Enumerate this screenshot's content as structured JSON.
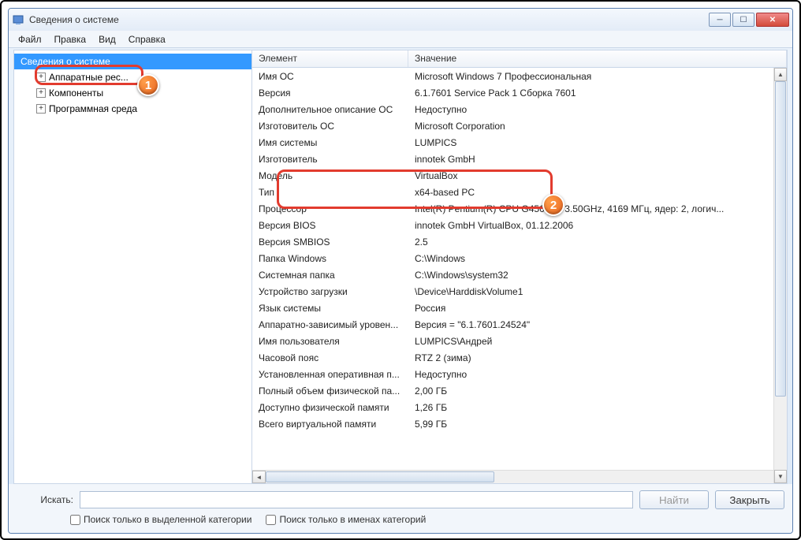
{
  "window": {
    "title": "Сведения о системе"
  },
  "menu": {
    "file": "Файл",
    "edit": "Правка",
    "view": "Вид",
    "help": "Справка"
  },
  "tree": {
    "root": "Сведения о системе",
    "hw": "Аппаратные рес...",
    "comp": "Компоненты",
    "soft": "Программная среда"
  },
  "list": {
    "header_element": "Элемент",
    "header_value": "Значение",
    "rows": [
      {
        "k": "Имя ОС",
        "v": "Microsoft Windows 7 Профессиональная"
      },
      {
        "k": "Версия",
        "v": "6.1.7601 Service Pack 1 Сборка 7601"
      },
      {
        "k": "Дополнительное описание ОС",
        "v": "Недоступно"
      },
      {
        "k": "Изготовитель ОС",
        "v": "Microsoft Corporation"
      },
      {
        "k": "Имя системы",
        "v": "LUMPICS"
      },
      {
        "k": "Изготовитель",
        "v": "innotek GmbH"
      },
      {
        "k": "Модель",
        "v": "VirtualBox"
      },
      {
        "k": "Тип",
        "v": "x64-based PC"
      },
      {
        "k": "Процессор",
        "v": "Intel(R) Pentium(R) CPU G4560 @ 3.50GHz, 4169 МГц, ядер: 2, логич..."
      },
      {
        "k": "Версия BIOS",
        "v": "innotek GmbH VirtualBox, 01.12.2006"
      },
      {
        "k": "Версия SMBIOS",
        "v": "2.5"
      },
      {
        "k": "Папка Windows",
        "v": "C:\\Windows"
      },
      {
        "k": "Системная папка",
        "v": "C:\\Windows\\system32"
      },
      {
        "k": "Устройство загрузки",
        "v": "\\Device\\HarddiskVolume1"
      },
      {
        "k": "Язык системы",
        "v": "Россия"
      },
      {
        "k": "Аппаратно-зависимый уровен...",
        "v": "Версия = \"6.1.7601.24524\""
      },
      {
        "k": "Имя пользователя",
        "v": "LUMPICS\\Андрей"
      },
      {
        "k": "Часовой пояс",
        "v": "RTZ 2 (зима)"
      },
      {
        "k": "Установленная оперативная п...",
        "v": "Недоступно"
      },
      {
        "k": "Полный объем физической па...",
        "v": "2,00 ГБ"
      },
      {
        "k": "Доступно физической памяти",
        "v": "1,26 ГБ"
      },
      {
        "k": "Всего виртуальной памяти",
        "v": "5,99 ГБ"
      }
    ]
  },
  "search": {
    "label": "Искать:",
    "find": "Найти",
    "close": "Закрыть",
    "opt_category": "Поиск только в выделенной категории",
    "opt_names": "Поиск только в именах категорий"
  },
  "badges": {
    "one": "1",
    "two": "2"
  }
}
